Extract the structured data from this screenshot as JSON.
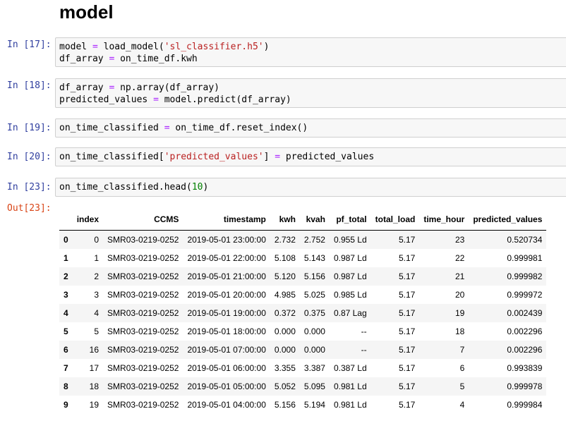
{
  "heading": "model",
  "cells": [
    {
      "prompt": "In [17]:",
      "lines": [
        "model = load_model('sl_classifier.h5')",
        "df_array = on_time_df.kwh"
      ]
    },
    {
      "prompt": "In [18]:",
      "lines": [
        "df_array = np.array(df_array)",
        "predicted_values = model.predict(df_array)"
      ]
    },
    {
      "prompt": "In [19]:",
      "lines": [
        "on_time_classified = on_time_df.reset_index()"
      ]
    },
    {
      "prompt": "In [20]:",
      "lines": [
        "on_time_classified['predicted_values'] = predicted_values"
      ]
    },
    {
      "prompt": "In [23]:",
      "lines": [
        "on_time_classified.head(10)"
      ]
    }
  ],
  "output": {
    "prompt": "Out[23]:",
    "columns": [
      "",
      "index",
      "CCMS",
      "timestamp",
      "kwh",
      "kvah",
      "pf_total",
      "total_load",
      "time_hour",
      "predicted_values"
    ],
    "rows": [
      [
        "0",
        "0",
        "SMR03-0219-0252",
        "2019-05-01 23:00:00",
        "2.732",
        "2.752",
        "0.955 Ld",
        "5.17",
        "23",
        "0.520734"
      ],
      [
        "1",
        "1",
        "SMR03-0219-0252",
        "2019-05-01 22:00:00",
        "5.108",
        "5.143",
        "0.987 Ld",
        "5.17",
        "22",
        "0.999981"
      ],
      [
        "2",
        "2",
        "SMR03-0219-0252",
        "2019-05-01 21:00:00",
        "5.120",
        "5.156",
        "0.987 Ld",
        "5.17",
        "21",
        "0.999982"
      ],
      [
        "3",
        "3",
        "SMR03-0219-0252",
        "2019-05-01 20:00:00",
        "4.985",
        "5.025",
        "0.985 Ld",
        "5.17",
        "20",
        "0.999972"
      ],
      [
        "4",
        "4",
        "SMR03-0219-0252",
        "2019-05-01 19:00:00",
        "0.372",
        "0.375",
        "0.87 Lag",
        "5.17",
        "19",
        "0.002439"
      ],
      [
        "5",
        "5",
        "SMR03-0219-0252",
        "2019-05-01 18:00:00",
        "0.000",
        "0.000",
        "--",
        "5.17",
        "18",
        "0.002296"
      ],
      [
        "6",
        "16",
        "SMR03-0219-0252",
        "2019-05-01 07:00:00",
        "0.000",
        "0.000",
        "--",
        "5.17",
        "7",
        "0.002296"
      ],
      [
        "7",
        "17",
        "SMR03-0219-0252",
        "2019-05-01 06:00:00",
        "3.355",
        "3.387",
        "0.387 Ld",
        "5.17",
        "6",
        "0.993839"
      ],
      [
        "8",
        "18",
        "SMR03-0219-0252",
        "2019-05-01 05:00:00",
        "5.052",
        "5.095",
        "0.981 Ld",
        "5.17",
        "5",
        "0.999978"
      ],
      [
        "9",
        "19",
        "SMR03-0219-0252",
        "2019-05-01 04:00:00",
        "5.156",
        "5.194",
        "0.981 Ld",
        "5.17",
        "4",
        "0.999984"
      ]
    ]
  }
}
